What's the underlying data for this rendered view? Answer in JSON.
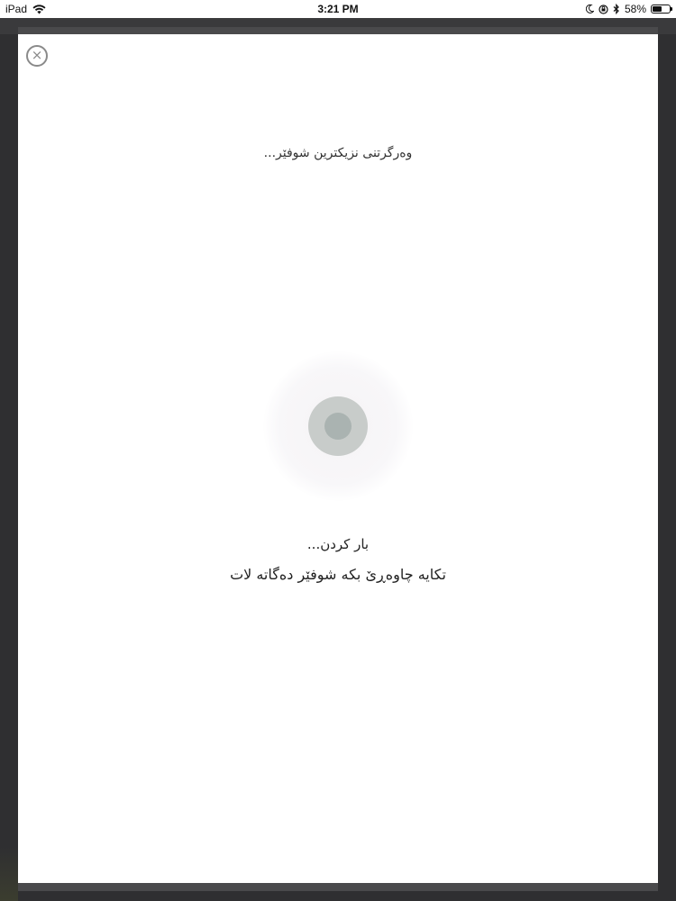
{
  "status_bar": {
    "device": "iPad",
    "time": "3:21 PM",
    "battery": "58%",
    "battery_level": 0.58,
    "icons": [
      "wifi-icon",
      "moon-icon",
      "orientation-lock-icon",
      "bluetooth-icon",
      "battery-icon"
    ]
  },
  "modal": {
    "close_icon": "×",
    "header_text": "وەرگرتنی نزیکترین شوفێر...",
    "loading_text": "بار کردن...",
    "wait_text": "تکایە چاوەڕێ بکە شوفێر دەگاتە لات"
  },
  "colors": {
    "backdrop": "#2f2f31",
    "modal_background": "#ffffff",
    "spinner_outer": "#c8ccca",
    "spinner_inner": "#aab3b1",
    "close_icon": "#8a8a8a"
  }
}
